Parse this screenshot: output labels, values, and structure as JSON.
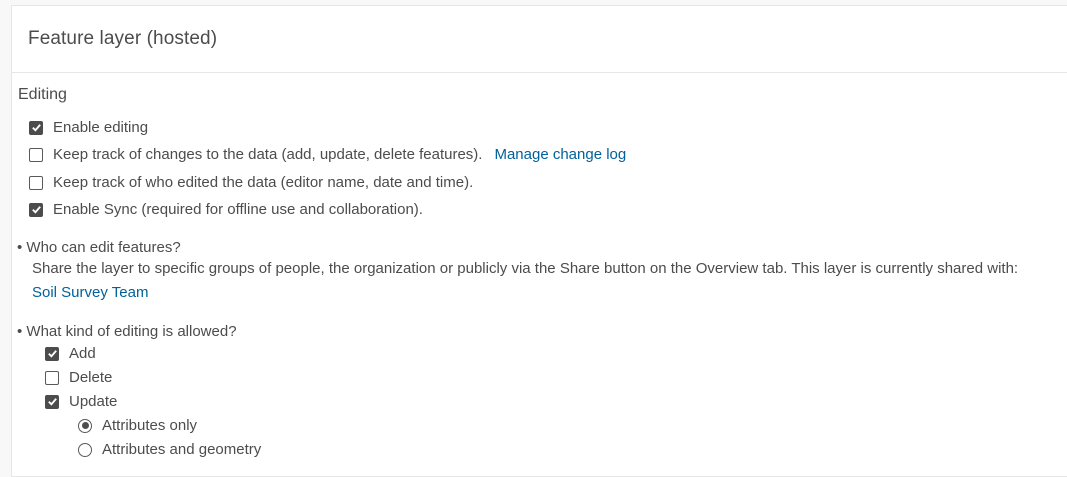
{
  "header": {
    "title": "Feature layer (hosted)"
  },
  "editing": {
    "section_title": "Editing",
    "options": [
      {
        "label": "Enable editing",
        "checked": true
      },
      {
        "label": "Keep track of changes to the data (add, update, delete features).",
        "checked": false,
        "link": "Manage change log"
      },
      {
        "label": "Keep track of who edited the data (editor name, date and time).",
        "checked": false
      },
      {
        "label": "Enable Sync (required for offline use and collaboration).",
        "checked": true
      }
    ]
  },
  "who_can_edit": {
    "question": "• Who can edit features?",
    "description": "Share the layer to specific groups of people, the organization or publicly via the Share button on the Overview tab. This layer is currently shared with: ",
    "shared_with": "Soil Survey Team"
  },
  "kind_of_editing": {
    "question": "• What kind of editing is allowed?",
    "options": [
      {
        "label": "Add",
        "checked": true
      },
      {
        "label": "Delete",
        "checked": false,
        "highlighted": true
      },
      {
        "label": "Update",
        "checked": true
      }
    ],
    "update_modes": [
      {
        "label": "Attributes only",
        "selected": true
      },
      {
        "label": "Attributes and geometry",
        "selected": false
      }
    ]
  },
  "colors": {
    "link": "#00619b",
    "highlight": "#fff200",
    "text": "#4c4c4c"
  }
}
